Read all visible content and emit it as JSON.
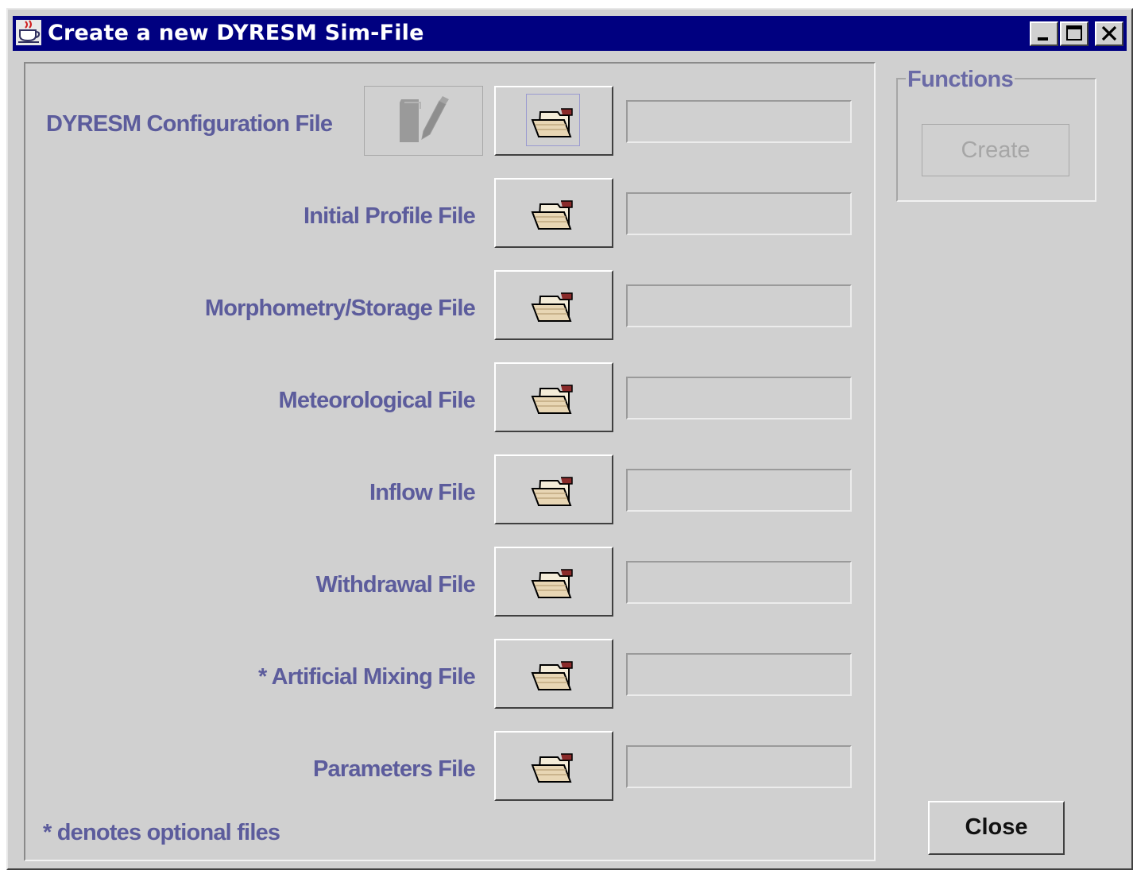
{
  "window": {
    "title": "Create a new DYRESM Sim-File",
    "app_icon": "java-coffee-cup-icon",
    "controls": [
      "minimize-icon",
      "maximize-icon",
      "close-icon"
    ]
  },
  "file_rows": [
    {
      "label": "DYRESM Configuration File",
      "has_edit_button": true,
      "edit_icon": "edit-pencil-icon",
      "browse_icon": "folder-open-icon",
      "path_value": ""
    },
    {
      "label": "Initial Profile File",
      "browse_icon": "folder-open-icon",
      "path_value": ""
    },
    {
      "label": "Morphometry/Storage File",
      "browse_icon": "folder-open-icon",
      "path_value": ""
    },
    {
      "label": "Meteorological File",
      "browse_icon": "folder-open-icon",
      "path_value": ""
    },
    {
      "label": "Inflow File",
      "browse_icon": "folder-open-icon",
      "path_value": ""
    },
    {
      "label": "Withdrawal File",
      "browse_icon": "folder-open-icon",
      "path_value": ""
    },
    {
      "label": "* Artificial Mixing File",
      "browse_icon": "folder-open-icon",
      "path_value": ""
    },
    {
      "label": "Parameters File",
      "browse_icon": "folder-open-icon",
      "path_value": ""
    }
  ],
  "footnote": "* denotes optional files",
  "functions": {
    "title": "Functions",
    "create_label": "Create",
    "create_enabled": false
  },
  "close_label": "Close",
  "colors": {
    "titlebar": "#000080",
    "background": "#d0d0d0",
    "label": "#5c5c9c"
  }
}
